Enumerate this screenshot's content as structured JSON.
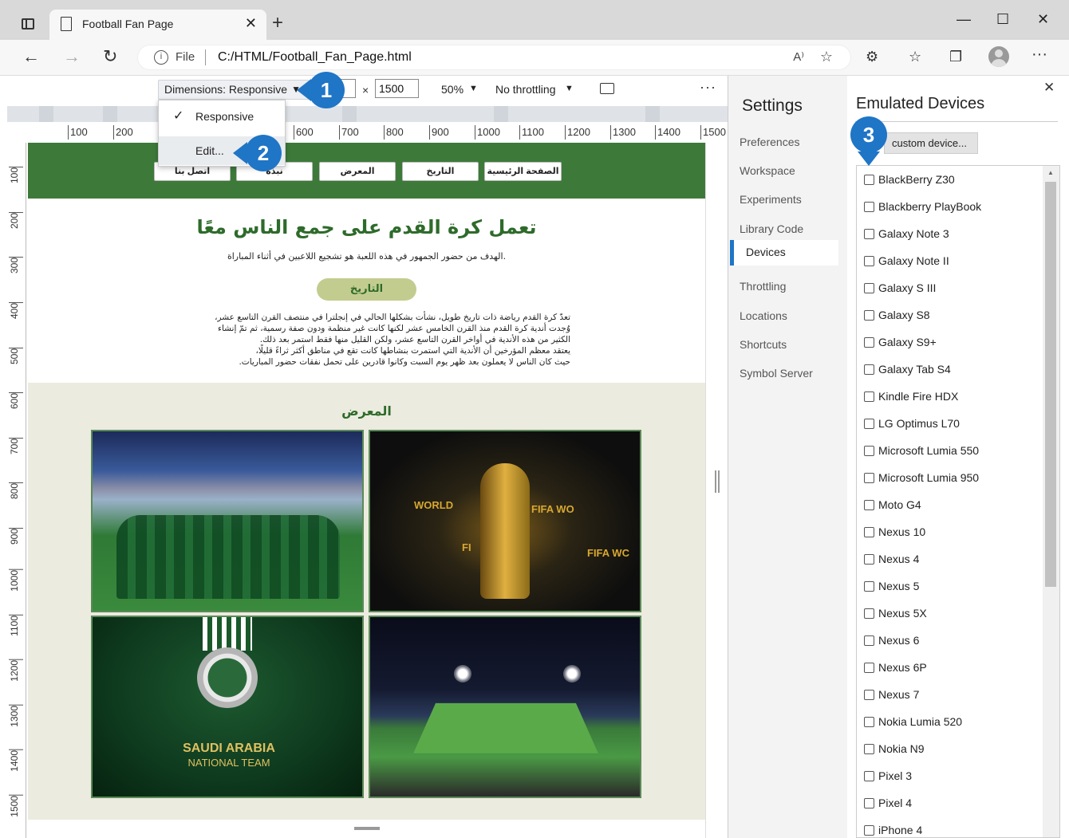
{
  "browser": {
    "tab_title": "Football Fan Page",
    "tab_close": "✕",
    "new_tab": "+",
    "window_controls": {
      "minimize": "—",
      "maximize": "☐",
      "close": "✕"
    },
    "scheme": "File",
    "url": "C:/HTML/Football_Fan_Page.html",
    "read_aloud": "A⁾",
    "favorite": "☆",
    "toolbar_more": "···"
  },
  "device_toolbar": {
    "dimensions_label": "Dimensions: Responsive",
    "width_value": "",
    "height_value": "1500",
    "times": "×",
    "zoom": "50%",
    "throttling": "No throttling",
    "more": "⋮"
  },
  "dropdown": {
    "items": [
      {
        "label": "Responsive",
        "checked": true
      },
      {
        "label": "Edit...",
        "checked": false
      }
    ]
  },
  "callouts": [
    "1",
    "2",
    "3"
  ],
  "ruler": {
    "h_labels": [
      "100",
      "200",
      "600",
      "700",
      "800",
      "900",
      "1000",
      "1100",
      "1200",
      "1300",
      "1400",
      "1500"
    ],
    "v_labels": [
      "100",
      "200",
      "300",
      "400",
      "500",
      "600",
      "700",
      "800",
      "900",
      "1000",
      "1100",
      "1200",
      "1300",
      "1400",
      "1500"
    ]
  },
  "site": {
    "nav": [
      "الصفحة الرئيسية",
      "التاريخ",
      "المعرض",
      "نبذة",
      "اتصل بنا"
    ],
    "hero_title": "تعمل كرة القدم على جمع الناس معًا",
    "hero_sub": "الهدف من حضور الجمهور في هذه اللعبة هو تشجيع اللاعبين في أثناء المباراة.",
    "history_button": "التاريخ",
    "history_lines": [
      "تعدّ كرة القدم رياضة ذات تاريخ طويل، نشأت بشكلها الحالي في إنجلترا في منتصف القرن التاسع عشر،",
      "وُجدت أندية كرة القدم منذ القرن الخامس عشر لكنها كانت غير منظمة ودون صفة رسمية، ثم تمّ إنشاء",
      "الكثير من هذه الأندية في أواخر القرن التاسع عشر، ولكن القليل منها فقط استمر بعد ذلك.",
      "يعتقد معظم المؤرخين أن الأندية التي استمرت بنشاطها كانت تقع في مناطق أكثر ثراءً قليلًا،",
      "حيث كان الناس لا يعملون بعد ظهر يوم السبت وكانوا قادرين على تحمل نفقات حضور المباريات."
    ],
    "gallery_title": "المعرض",
    "museum_labels": [
      "WORLD",
      "FIFA WO",
      "FI",
      "FIFA WC"
    ],
    "team_title": "SAUDI ARABIA",
    "team_sub": "NATIONAL TEAM"
  },
  "settings": {
    "title": "Settings",
    "items": [
      "Preferences",
      "Workspace",
      "Experiments",
      "Library Code",
      "Devices",
      "Throttling",
      "Locations",
      "Shortcuts",
      "Symbol Server"
    ],
    "active": "Devices"
  },
  "devices": {
    "title": "Emulated Devices",
    "close": "✕",
    "add_button": "Add custom device...",
    "add_button_visible": "custom device...",
    "list": [
      "BlackBerry Z30",
      "Blackberry PlayBook",
      "Galaxy Note 3",
      "Galaxy Note II",
      "Galaxy S III",
      "Galaxy S8",
      "Galaxy S9+",
      "Galaxy Tab S4",
      "Kindle Fire HDX",
      "LG Optimus L70",
      "Microsoft Lumia 550",
      "Microsoft Lumia 950",
      "Moto G4",
      "Nexus 10",
      "Nexus 4",
      "Nexus 5",
      "Nexus 5X",
      "Nexus 6",
      "Nexus 6P",
      "Nexus 7",
      "Nokia Lumia 520",
      "Nokia N9",
      "Pixel 3",
      "Pixel 4",
      "iPhone 4"
    ]
  },
  "colors": {
    "site_green": "#3d7a3a",
    "callout_blue": "#1f75c6",
    "gallery_bg": "#ecebdf"
  }
}
